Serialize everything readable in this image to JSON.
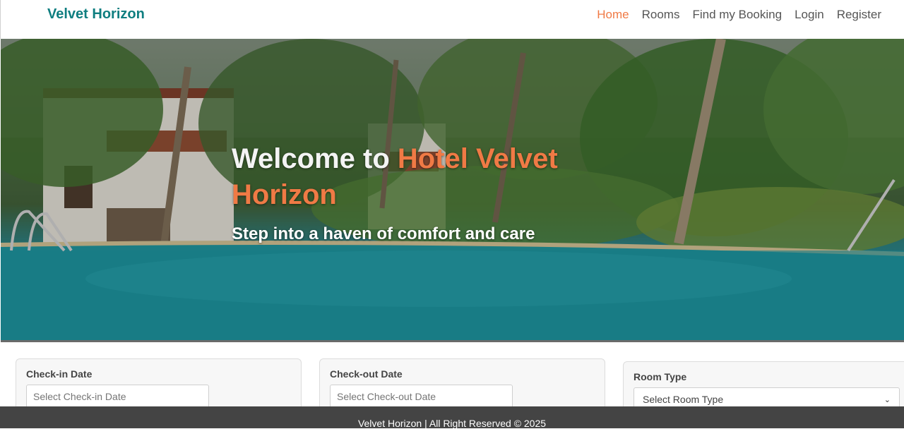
{
  "nav": {
    "brand": "Velvet Horizon",
    "links": [
      "Home",
      "Rooms",
      "Find my Booking",
      "Login",
      "Register"
    ],
    "active": "Home"
  },
  "hero": {
    "title_prefix": "Welcome to ",
    "title_accent": "Hotel Velvet Horizon",
    "subtitle": "Step into a haven of comfort and care"
  },
  "booking": {
    "checkin_label": "Check-in Date",
    "checkin_placeholder": "Select Check-in Date",
    "checkout_label": "Check-out Date",
    "checkout_placeholder": "Select Check-out Date",
    "room_label": "Room Type",
    "room_selected": "Select Room Type"
  },
  "footer": {
    "text": "Velvet Horizon | All Right Reserved © 2025"
  },
  "colors": {
    "brand": "#0f7e80",
    "accent": "#f07a45",
    "footer_bg": "#444444"
  }
}
